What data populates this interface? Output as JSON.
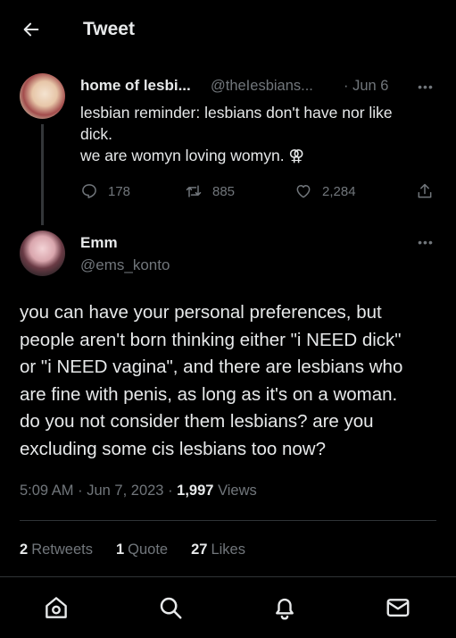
{
  "header": {
    "title": "Tweet",
    "back_icon": "arrow-left-icon"
  },
  "parent_tweet": {
    "display_name": "home of lesbi...",
    "handle": "@theIesbians...",
    "date": "· Jun 6",
    "more_label": "•••",
    "text_lines": [
      "lesbian reminder: lesbians don't have nor like",
      "dick.",
      "we are womyn loving womyn. ⚢"
    ],
    "replies": "178",
    "retweets": "885",
    "likes": "2,284"
  },
  "focus_tweet": {
    "display_name": "Emm",
    "handle": "@ems_konto",
    "more_label": "•••",
    "text_lines": [
      "you can have your personal preferences, but",
      "people aren't born thinking either \"i NEED dick\"",
      "or \"i NEED vagina\", and there are lesbians who",
      "are fine with penis, as long as it's on a woman.",
      "do you not consider them lesbians? are you",
      "excluding some cis lesbians too now?"
    ],
    "time": "5:09 AM",
    "date": "Jun 7, 2023",
    "sep": "·",
    "views_count": "1,997",
    "views_label": "Views",
    "retweets_count": "2",
    "retweets_label": "Retweets",
    "quotes_count": "1",
    "quotes_label": "Quote",
    "likes_count": "27",
    "likes_label": "Likes"
  },
  "nav": {
    "items": [
      "home-icon",
      "search-icon",
      "notifications-icon",
      "messages-icon"
    ]
  },
  "colors": {
    "background": "#000000",
    "text": "#e7e9ea",
    "muted": "#71767b",
    "divider": "#2f3336"
  }
}
